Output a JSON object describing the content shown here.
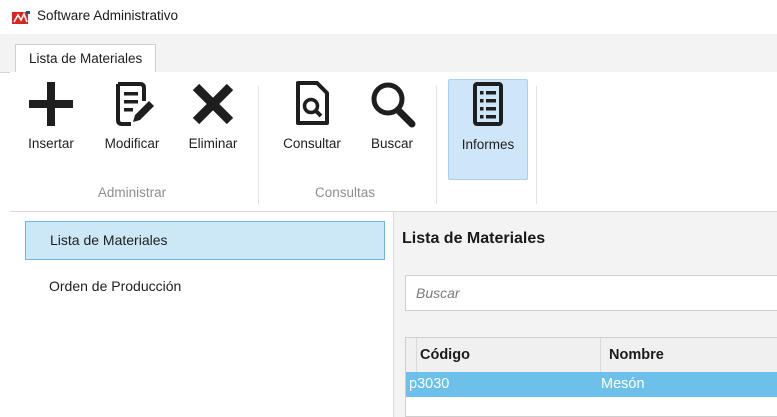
{
  "window": {
    "title": "Software Administrativo",
    "logo_icon": "app-logo-icon"
  },
  "tabs": [
    {
      "label": "Lista de Materiales",
      "active": true
    }
  ],
  "ribbon": {
    "groups": [
      {
        "label": "Administrar",
        "buttons": [
          {
            "label": "Insertar",
            "icon": "plus-icon"
          },
          {
            "label": "Modificar",
            "icon": "edit-document-icon"
          },
          {
            "label": "Eliminar",
            "icon": "x-icon"
          }
        ]
      },
      {
        "label": "Consultas",
        "buttons": [
          {
            "label": "Consultar",
            "icon": "document-search-icon"
          },
          {
            "label": "Buscar",
            "icon": "magnifier-icon"
          }
        ]
      },
      {
        "label": "",
        "buttons": [
          {
            "label": "Informes",
            "icon": "report-list-icon",
            "active": true
          }
        ]
      }
    ]
  },
  "sidebar": {
    "items": [
      {
        "label": "Lista de Materiales",
        "selected": true
      },
      {
        "label": "Orden de Producción",
        "selected": false
      }
    ]
  },
  "main": {
    "title": "Lista de Materiales",
    "search": {
      "placeholder": "Buscar",
      "value": ""
    },
    "table": {
      "columns": [
        "Código",
        "Nombre"
      ],
      "rows": [
        [
          "p3030",
          "Mesón"
        ]
      ],
      "selected_row": 0
    }
  },
  "colors": {
    "selection_blue": "#6cc0ea",
    "nav_selected_bg": "#cce8f6",
    "nav_selected_border": "#6fb6e6",
    "active_button_bg": "#cfe6f8",
    "logo_red": "#d9261c"
  }
}
